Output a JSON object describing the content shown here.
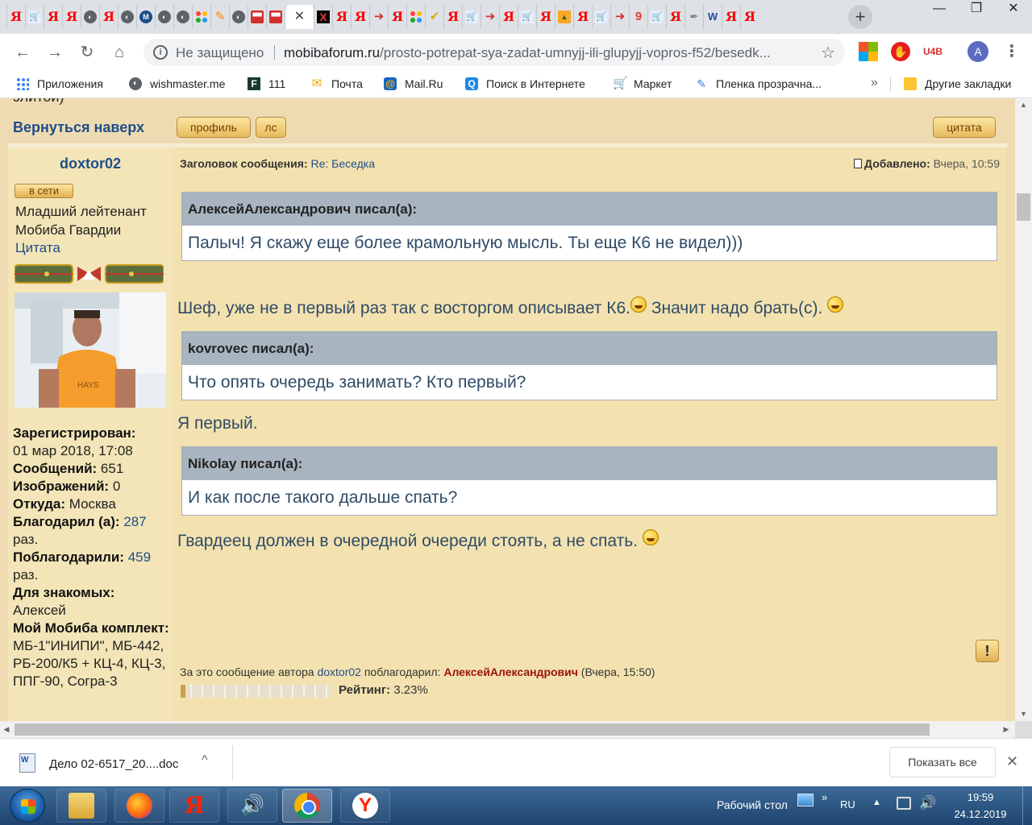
{
  "browser": {
    "tab_icons": [
      "ya",
      "cart",
      "ya",
      "ya",
      "disk",
      "ya",
      "disk",
      "bluecirc",
      "disk",
      "disk",
      "dots",
      "orange",
      "disk",
      "redbox",
      "redbox",
      "close",
      "xbox",
      "ya",
      "ya",
      "arrow",
      "ya",
      "dots",
      "check",
      "ya",
      "cart",
      "arrow",
      "ya",
      "cart",
      "ya",
      "img",
      "ya",
      "cart",
      "arrow",
      "pin",
      "cart",
      "ya",
      "feather",
      "blueW",
      "ya",
      "ya"
    ],
    "active_tab_close": "✕",
    "new_tab": "+",
    "window_controls": {
      "minimize": "—",
      "restore": "❐",
      "close": "✕"
    },
    "toolbar": {
      "back": "←",
      "forward": "→",
      "reload": "↻",
      "home": "⌂"
    },
    "security_label": "Не защищено",
    "url_host": "mobibaforum.ru",
    "url_path": "/prosto-potrepat-sya-zadat-umnyjj-ili-glupyjj-vopros-f52/besedk...",
    "profile_initial": "A",
    "extensions": {
      "u4b": "U4B",
      "abp": "ABP"
    },
    "bookmarks": [
      {
        "label": "Приложения",
        "icon": "apps-icon"
      },
      {
        "label": "wishmaster.me",
        "icon": "globe-icon"
      },
      {
        "label": "111",
        "icon": "f-icon"
      },
      {
        "label": "Почта",
        "icon": "mail-icon"
      },
      {
        "label": "Mail.Ru",
        "icon": "at-icon"
      },
      {
        "label": "Поиск в Интернете",
        "icon": "search-icon"
      },
      {
        "label": "Маркет",
        "icon": "cart-icon"
      },
      {
        "label": "Пленка прозрачна...",
        "icon": "film-icon"
      }
    ],
    "bookmarks_more": "»",
    "other_bookmarks": "Другие закладки"
  },
  "page": {
    "cut_text": "элитой)",
    "back_to_top": "Вернуться наверх",
    "btn_profile": "профиль",
    "btn_pm": "лс",
    "btn_quote": "цитата",
    "author": {
      "name": "doxtor02",
      "online": "в сети",
      "rank": "Младший лейтенант Мобиба Гвардии",
      "quote_link": "Цитата",
      "registered_label": "Зарегистрирован:",
      "registered_value": "01 мар 2018, 17:08",
      "posts_label": "Сообщений:",
      "posts_value": "651",
      "images_label": "Изображений:",
      "images_value": "0",
      "from_label": "Откуда:",
      "from_value": "Москва",
      "thanked_label": "Благодарил (а):",
      "thanked_value": "287",
      "thanked_suffix": "раз.",
      "was_thanked_label": "Поблагодарили:",
      "was_thanked_value": "459",
      "was_thanked_suffix": "раз.",
      "for_friends_label": "Для знакомых:",
      "for_friends_value": "Алексей",
      "kit_label": "Мой Мобиба комплект:",
      "kit_value": "МБ-1\"ИНИПИ\", МБ-442, РБ-200/К5 + КЦ-4, КЦ-3, ППГ-90, Согра-3"
    },
    "post": {
      "subject_label": "Заголовок сообщения:",
      "subject_value": "Re: Беседка",
      "added_label": "Добавлено:",
      "added_value": "Вчера, 10:59",
      "quotes": [
        {
          "author": "АлексейАлександрович писал(а):",
          "text": "Палыч! Я скажу еще более крамольную мысль. Ты еще К6 не видел)))"
        },
        {
          "author": "kovrovec писал(а):",
          "text": "Что опять очередь занимать? Кто первый?"
        },
        {
          "author": "Nikolay писал(а):",
          "text": "И как после такого дальше спать?"
        }
      ],
      "reply1_a": "Шеф, уже не в первый раз так с восторгом описывает К6.",
      "reply1_b": "Значит надо брать(с).",
      "reply2": "Я первый.",
      "reply3": "Гвардеец должен в очередной очереди стоять, а не спать.",
      "report": "!",
      "thanks_prefix": "За это сообщение автора",
      "thanks_author": "doxtor02",
      "thanks_mid": "поблагодарил:",
      "thanks_user": "АлексейАлександрович",
      "thanks_time": "(Вчера, 15:50)",
      "rating_label": "Рейтинг:",
      "rating_value": "3.23%"
    }
  },
  "downloads": {
    "file": "Дело 02-6517_20....doc",
    "chevron": "^",
    "show_all": "Показать все",
    "close": "✕"
  },
  "taskbar": {
    "desktop_label": "Рабочий стол",
    "lang": "RU",
    "time": "19:59",
    "date": "24.12.2019"
  }
}
